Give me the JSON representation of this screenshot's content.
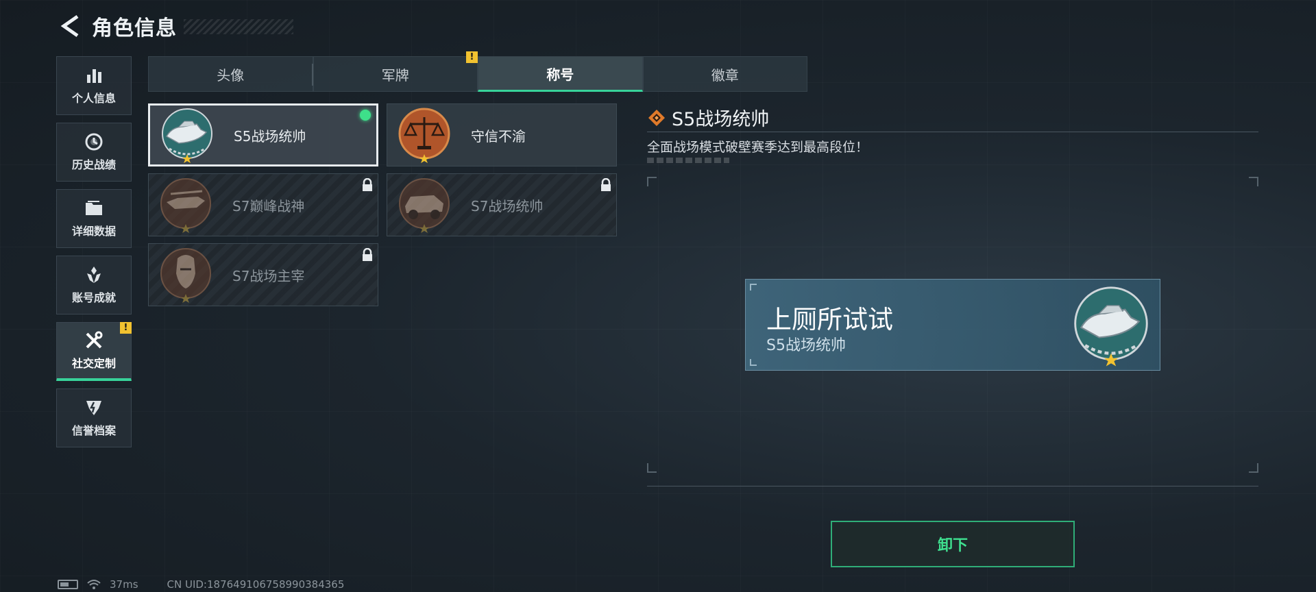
{
  "header": {
    "title": "角色信息"
  },
  "sidebar": {
    "items": [
      {
        "label": "个人信息",
        "icon": "bar-chart-icon",
        "active": false,
        "warn": false
      },
      {
        "label": "历史战绩",
        "icon": "clock-history-icon",
        "active": false,
        "warn": false
      },
      {
        "label": "详细数据",
        "icon": "folder-icon",
        "active": false,
        "warn": false
      },
      {
        "label": "账号成就",
        "icon": "achievement-icon",
        "active": false,
        "warn": false
      },
      {
        "label": "社交定制",
        "icon": "tools-icon",
        "active": true,
        "warn": true
      },
      {
        "label": "信誉档案",
        "icon": "shield-emblem-icon",
        "active": false,
        "warn": false
      }
    ]
  },
  "tabs": [
    {
      "label": "头像",
      "active": false,
      "warn": false
    },
    {
      "label": "军牌",
      "active": false,
      "warn": true
    },
    {
      "label": "称号",
      "active": true,
      "warn": false
    },
    {
      "label": "徽章",
      "active": false,
      "warn": false
    }
  ],
  "warn_mark": "!",
  "titles": [
    {
      "name": "S5战场统帅",
      "badge": "speedboat-badge",
      "selected": true,
      "equipped": true,
      "locked": false
    },
    {
      "name": "守信不渝",
      "badge": "scales-badge",
      "selected": false,
      "equipped": false,
      "locked": false
    },
    {
      "name": "S7巅峰战神",
      "badge": "gunship-badge",
      "selected": false,
      "equipped": false,
      "locked": true
    },
    {
      "name": "S7战场统帅",
      "badge": "armored-vehicle-badge",
      "selected": false,
      "equipped": false,
      "locked": true
    },
    {
      "name": "S7战场主宰",
      "badge": "soldier-badge",
      "selected": false,
      "equipped": false,
      "locked": true
    }
  ],
  "detail": {
    "name": "S5战场统帅",
    "description": "全面战场模式破壁赛季达到最高段位！"
  },
  "preview": {
    "player_name": "上厕所试试",
    "title": "S5战场统帅"
  },
  "actions": {
    "unequip_label": "卸下"
  },
  "status_bar": {
    "ping": "37ms",
    "uid": "CN UID:187649106758990384365"
  },
  "colors": {
    "accent_green": "#38d39a",
    "warn_yellow": "#f2c230",
    "plate_blue": "#40687e",
    "badge_bronze": "#b0552a"
  }
}
